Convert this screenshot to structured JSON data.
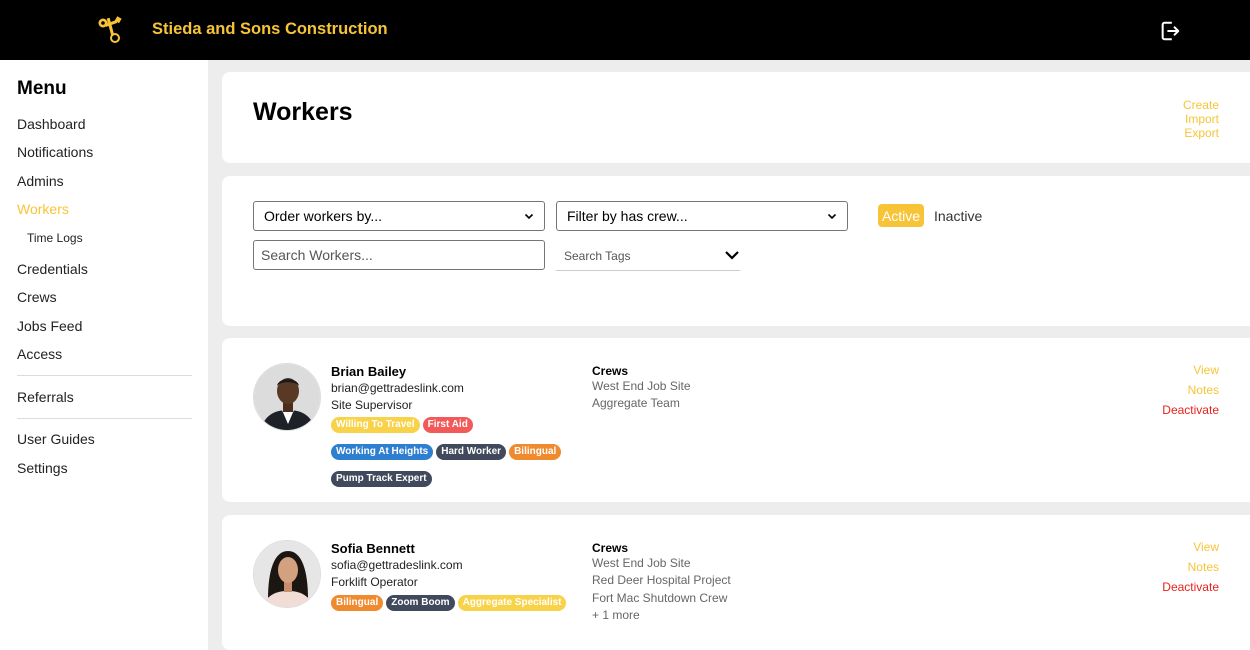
{
  "app": {
    "title": "Stieda and Sons Construction",
    "logo_icon": "wrench-link-icon",
    "logout_icon": "logout-icon"
  },
  "colors": {
    "accent": "#f8c437",
    "danger": "#e8221c",
    "topbar": "#000000"
  },
  "sidebar": {
    "title": "Menu",
    "items": [
      {
        "label": "Dashboard"
      },
      {
        "label": "Notifications"
      },
      {
        "label": "Admins"
      },
      {
        "label": "Workers",
        "active": true
      },
      {
        "label": "Time Logs",
        "sub": true
      },
      {
        "label": "Credentials"
      },
      {
        "label": "Crews"
      },
      {
        "label": "Jobs Feed"
      },
      {
        "label": "Access"
      },
      {
        "label": "Referrals"
      },
      {
        "label": "User Guides"
      },
      {
        "label": "Settings"
      }
    ]
  },
  "header": {
    "title": "Workers",
    "actions": [
      "Create",
      "Import",
      "Export"
    ]
  },
  "filters": {
    "order_by": "Order workers by...",
    "filter_crew": "Filter by has crew...",
    "status_active": "Active",
    "status_inactive": "Inactive",
    "search_placeholder": "Search Workers...",
    "tags_placeholder": "Search Tags"
  },
  "workers": [
    {
      "name": "Brian Bailey",
      "email": "brian@gettradeslink.com",
      "role": "Site Supervisor",
      "tags": [
        {
          "label": "Willing To Travel",
          "color": "#f8d34a"
        },
        {
          "label": "First Aid",
          "color": "#f25a5a"
        },
        {
          "label": "Working At Heights",
          "color": "#2e7fd0"
        },
        {
          "label": "Hard Worker",
          "color": "#414a5c"
        },
        {
          "label": "Bilingual",
          "color": "#ef8a2e"
        },
        {
          "label": "Pump Track Expert",
          "color": "#414a5c"
        }
      ],
      "crews_label": "Crews",
      "crews": [
        "West End Job Site",
        "Aggregate Team"
      ],
      "actions": {
        "view": "View",
        "notes": "Notes",
        "deactivate": "Deactivate"
      }
    },
    {
      "name": "Sofia Bennett",
      "email": "sofia@gettradeslink.com",
      "role": "Forklift Operator",
      "tags": [
        {
          "label": "Bilingual",
          "color": "#ef8a2e"
        },
        {
          "label": "Zoom Boom",
          "color": "#414a5c"
        },
        {
          "label": "Aggregate Specialist",
          "color": "#f8d34a"
        }
      ],
      "crews_label": "Crews",
      "crews": [
        "West End Job Site",
        "Red Deer Hospital Project",
        "Fort Mac Shutdown Crew",
        "+ 1 more"
      ],
      "actions": {
        "view": "View",
        "notes": "Notes",
        "deactivate": "Deactivate"
      }
    }
  ]
}
